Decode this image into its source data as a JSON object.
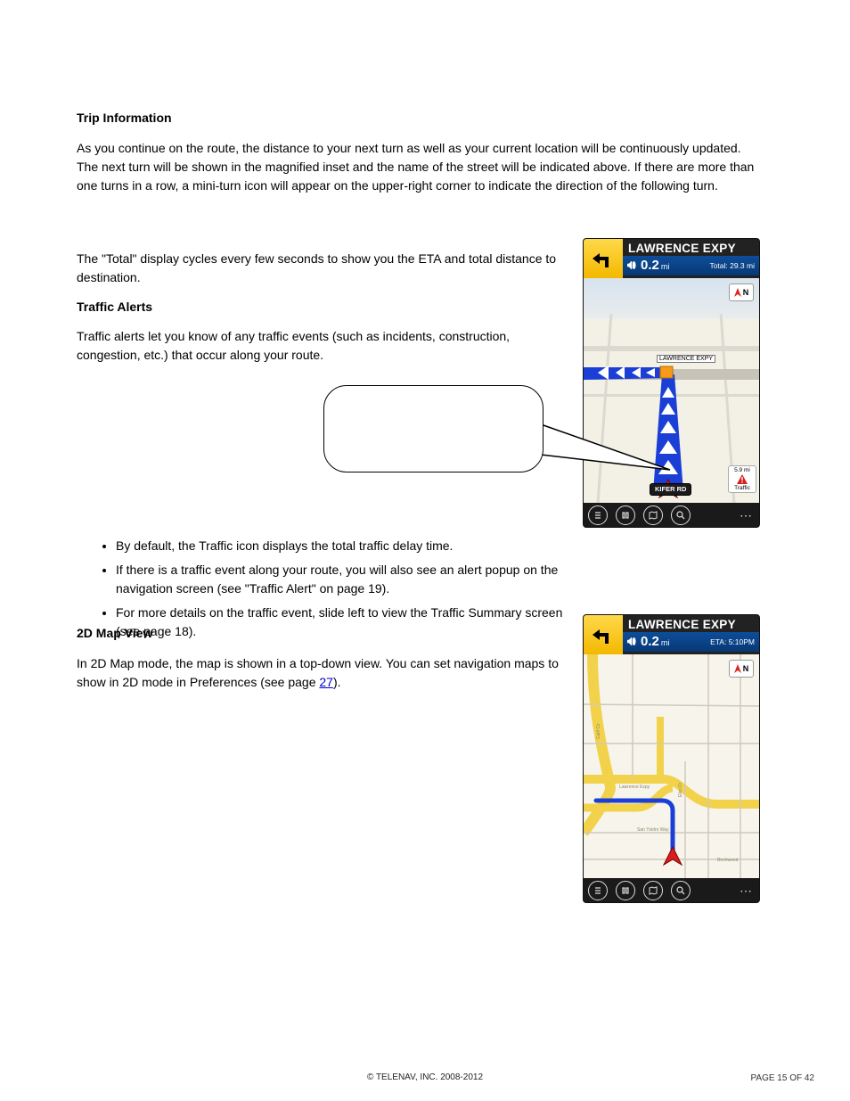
{
  "section": {
    "heading_trip_info": "Trip Information",
    "para_trip_info_1": "As you continue on the route, the distance to your next turn as well as your current location will be continuously updated. The next turn will be shown in the magnified inset and the name of the street will be indicated above. If there are more than one turns in a row, a mini-turn icon will appear on the upper-right corner to indicate the direction of the following turn.",
    "para_trip_info_2": "The \"Total\" display cycles every few seconds to show you the ETA and total distance to destination.",
    "heading_traffic_alerts": "Traffic Alerts",
    "para_traffic_intro": "Traffic alerts let you know of any traffic events (such as incidents, construction, congestion, etc.) that occur along your route.",
    "traffic_bullets": [
      "By default, the Traffic icon displays the total traffic delay time.",
      "If there is a traffic event along your route, you will also see an alert popup on the navigation screen (see \"Traffic Alert\" on page 19).",
      "For more details on the traffic event, slide left to view the Traffic Summary screen (see page 18)."
    ],
    "heading_2d_map": "2D Map View",
    "para_2d_map": "In 2D Map mode, the map is shown in a top-down view. You can set navigation maps to show in 2D mode in Preferences (see page 27)."
  },
  "phone1": {
    "street": "LAWRENCE EXPY",
    "distance": "0.2",
    "distance_unit": "mi",
    "total": "Total: 29.3 mi",
    "compass": "N",
    "expwy_label": "LAWRENCE EXPY",
    "current_road": "KIFER RD",
    "traffic": {
      "dist": "5.9 mi",
      "label": "Traffic"
    }
  },
  "phone2": {
    "street": "LAWRENCE EXPY",
    "distance": "0.2",
    "distance_unit": "mi",
    "eta": "ETA: 5:10PM",
    "compass": "N"
  },
  "footer": {
    "copyright": "© TELENAV, INC. 2008-2012",
    "page": "PAGE 15 OF 42"
  }
}
